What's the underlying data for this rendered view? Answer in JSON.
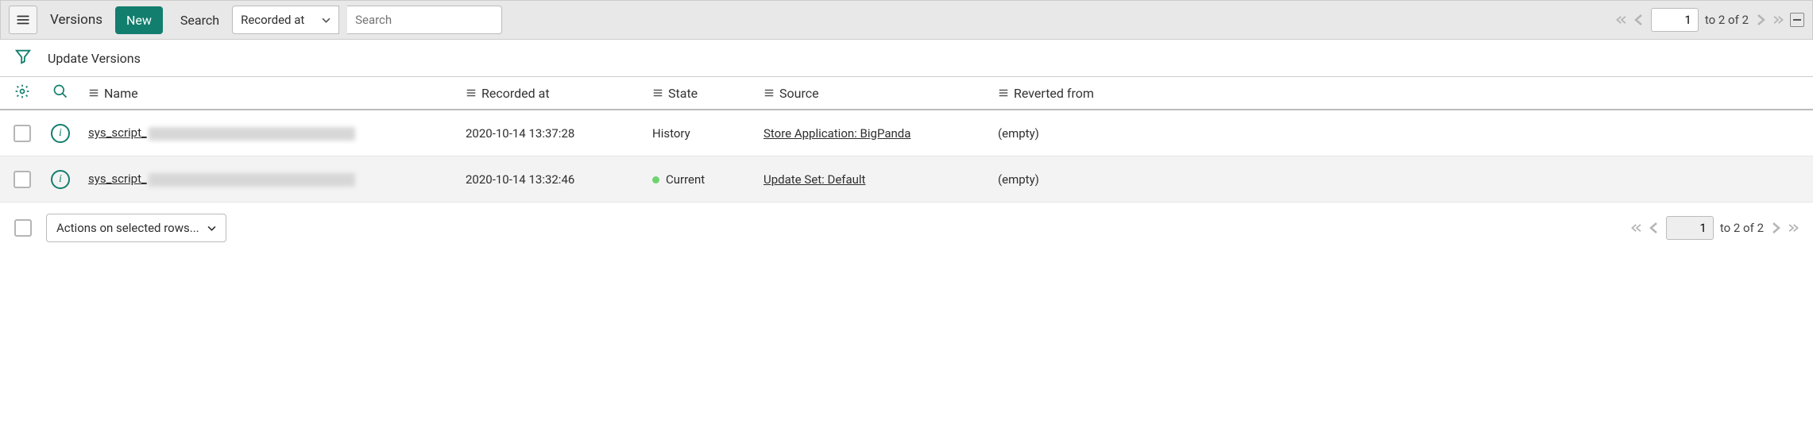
{
  "header": {
    "title": "Versions",
    "new_button": "New",
    "search_label": "Search",
    "select_field": "Recorded at",
    "search_placeholder": "Search"
  },
  "pager": {
    "page": "1",
    "to": "to",
    "shown": "2",
    "of_label": "of",
    "total": "2"
  },
  "subheader": {
    "breadcrumb": "Update Versions"
  },
  "columns": {
    "name": "Name",
    "recorded": "Recorded at",
    "state": "State",
    "source": "Source",
    "reverted": "Reverted from"
  },
  "rows": [
    {
      "name_prefix": "sys_script_",
      "recorded": "2020-10-14 13:37:28",
      "state": "History",
      "has_dot": false,
      "source": "Store Application: BigPanda",
      "reverted": "(empty)"
    },
    {
      "name_prefix": "sys_script_",
      "recorded": "2020-10-14 13:32:46",
      "state": "Current",
      "has_dot": true,
      "source": "Update Set: Default",
      "reverted": "(empty)"
    }
  ],
  "footer": {
    "actions_label": "Actions on selected rows..."
  }
}
